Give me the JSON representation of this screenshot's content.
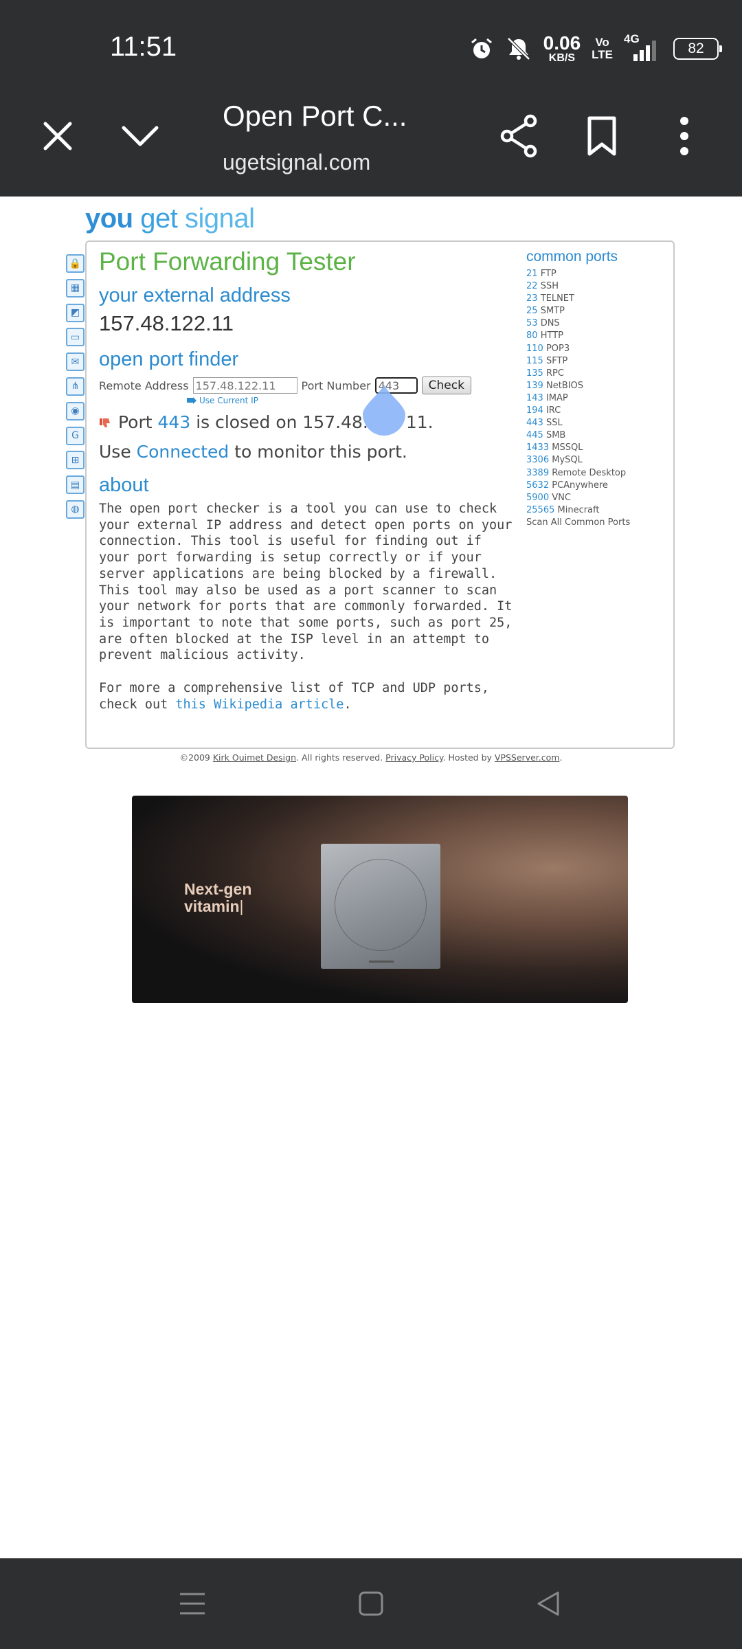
{
  "status_bar": {
    "time": "11:51",
    "net_speed_value": "0.06",
    "net_speed_unit": "KB/S",
    "volte_top": "Vo",
    "volte_bottom": "LTE",
    "network": "4G",
    "battery": "82"
  },
  "browser": {
    "tab_title": "Open Port C...",
    "url": "ugetsignal.com"
  },
  "logo": {
    "you": "you",
    "get": "get",
    "signal": "signal"
  },
  "main": {
    "title": "Port Forwarding Tester",
    "external_heading": "your external address",
    "external_ip": "157.48.122.11",
    "finder_heading": "open port finder",
    "remote_label": "Remote Address",
    "remote_value": "157.48.122.11",
    "port_label": "Port Number",
    "port_value": "443",
    "check_label": "Check",
    "use_current_ip": "Use Current IP",
    "result_prefix": "Port",
    "result_port": "443",
    "result_middle": "is closed on 157.48.",
    "result_suffix": "11.",
    "monitor_prefix": "Use",
    "monitor_link": "Connected",
    "monitor_suffix": "to monitor this port.",
    "about_heading": "about",
    "about_text": "The open port checker is a tool you can use to check your external IP address and detect open ports on your connection. This tool is useful for finding out if your port forwarding is setup correctly or if your server applications are being blocked by a firewall. This tool may also be used as a port scanner to scan your network for ports that are commonly forwarded. It is important to note that some ports, such as port 25, are often blocked at the ISP level in an attempt to prevent malicious activity.",
    "more_prefix": "For more a comprehensive list of TCP and UDP ports, check out",
    "more_link": "this Wikipedia article",
    "more_suffix": "."
  },
  "common_ports": {
    "title": "common ports",
    "items": [
      {
        "port": "21",
        "name": "FTP"
      },
      {
        "port": "22",
        "name": "SSH"
      },
      {
        "port": "23",
        "name": "TELNET"
      },
      {
        "port": "25",
        "name": "SMTP"
      },
      {
        "port": "53",
        "name": "DNS"
      },
      {
        "port": "80",
        "name": "HTTP"
      },
      {
        "port": "110",
        "name": "POP3"
      },
      {
        "port": "115",
        "name": "SFTP"
      },
      {
        "port": "135",
        "name": "RPC"
      },
      {
        "port": "139",
        "name": "NetBIOS"
      },
      {
        "port": "143",
        "name": "IMAP"
      },
      {
        "port": "194",
        "name": "IRC"
      },
      {
        "port": "443",
        "name": "SSL"
      },
      {
        "port": "445",
        "name": "SMB"
      },
      {
        "port": "1433",
        "name": "MSSQL"
      },
      {
        "port": "3306",
        "name": "MySQL"
      },
      {
        "port": "3389",
        "name": "Remote Desktop"
      },
      {
        "port": "5632",
        "name": "PCAnywhere"
      },
      {
        "port": "5900",
        "name": "VNC"
      },
      {
        "port": "25565",
        "name": "Minecraft"
      }
    ],
    "scan_all": "Scan All Common Ports"
  },
  "footer": {
    "copyright": "©2009",
    "author_link": "Kirk Ouimet Design",
    "rights": ". All rights reserved.",
    "privacy_link": "Privacy Policy",
    "hosted": ". Hosted by",
    "host_link": "VPSServer.com",
    "end": "."
  },
  "ad": {
    "line1": "Next-gen",
    "line2": "vitamin"
  },
  "colors": {
    "bar_bg": "#2e2f31",
    "brand_green": "#5bb245",
    "link_blue": "#2b8bcf"
  },
  "icons": [
    "close-icon",
    "chevron-down-icon",
    "share-icon",
    "bookmark-icon",
    "more-vert-icon",
    "menu-icon",
    "home-square-icon",
    "back-triangle-icon"
  ]
}
